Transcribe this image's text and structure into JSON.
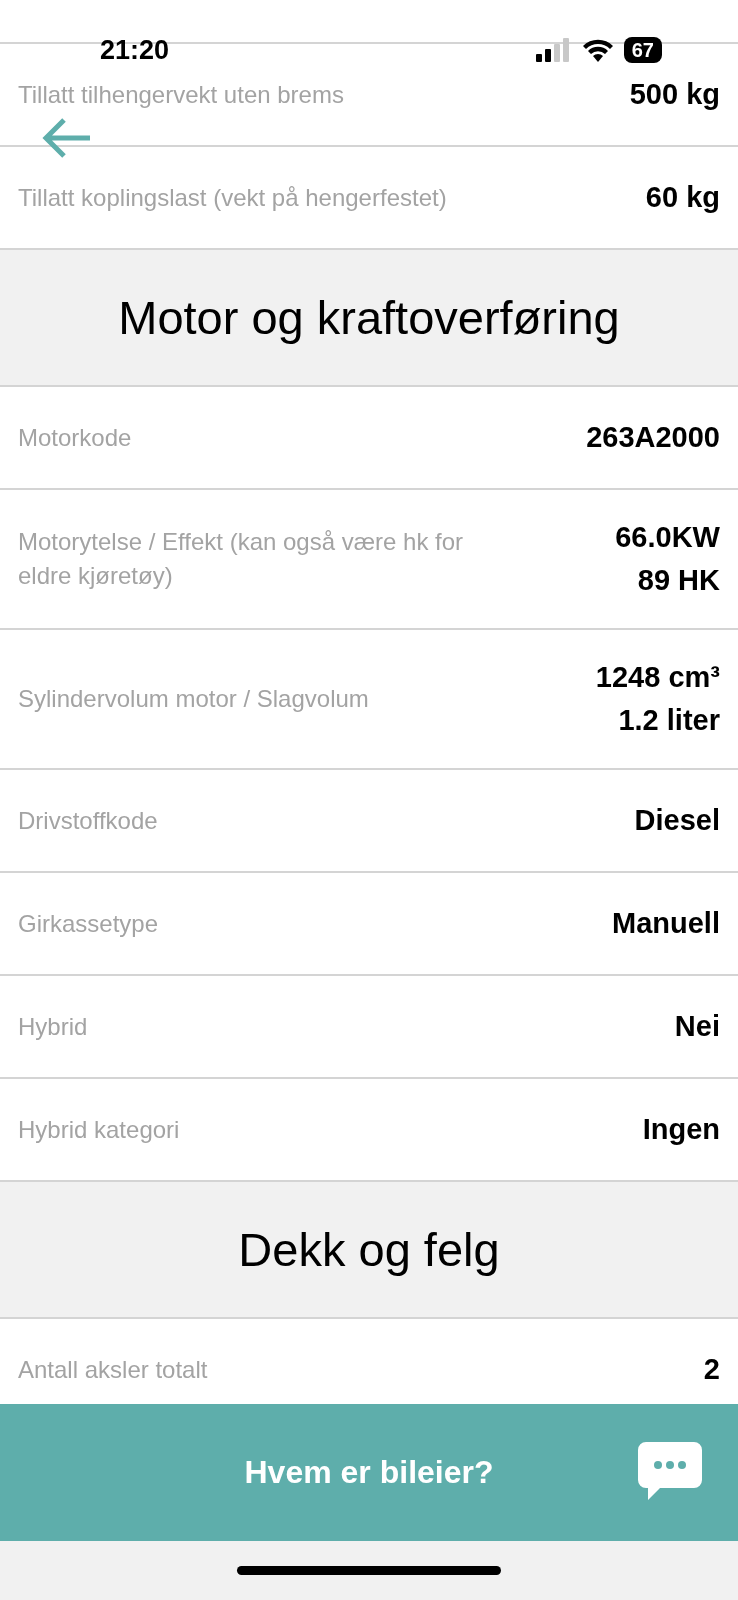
{
  "status_bar": {
    "time": "21:20",
    "battery": "67"
  },
  "items": [
    {
      "kind": "row",
      "label": "Tillatt tilhengervekt uten brems",
      "values": [
        "500 kg"
      ]
    },
    {
      "kind": "row",
      "label": "Tillatt koplingslast (vekt på hengerfestet)",
      "values": [
        "60 kg"
      ]
    },
    {
      "kind": "header",
      "title": "Motor og kraftoverføring"
    },
    {
      "kind": "row",
      "label": "Motorkode",
      "values": [
        "263A2000"
      ]
    },
    {
      "kind": "row",
      "label": "Motorytelse / Effekt (kan også være hk for eldre kjøretøy)",
      "values": [
        "66.0KW",
        "89 HK"
      ]
    },
    {
      "kind": "row",
      "label": "Sylindervolum motor / Slagvolum",
      "values": [
        "1248 cm³",
        "1.2 liter"
      ]
    },
    {
      "kind": "row",
      "label": "Drivstoffkode",
      "values": [
        "Diesel"
      ]
    },
    {
      "kind": "row",
      "label": "Girkassetype",
      "values": [
        "Manuell"
      ]
    },
    {
      "kind": "row",
      "label": "Hybrid",
      "values": [
        "Nei"
      ]
    },
    {
      "kind": "row",
      "label": "Hybrid kategori",
      "values": [
        "Ingen"
      ]
    },
    {
      "kind": "header",
      "title": "Dekk og felg"
    },
    {
      "kind": "row",
      "label": "Antall aksler totalt",
      "values": [
        "2"
      ]
    }
  ],
  "action_bar": {
    "label": "Hvem er bileier?"
  }
}
